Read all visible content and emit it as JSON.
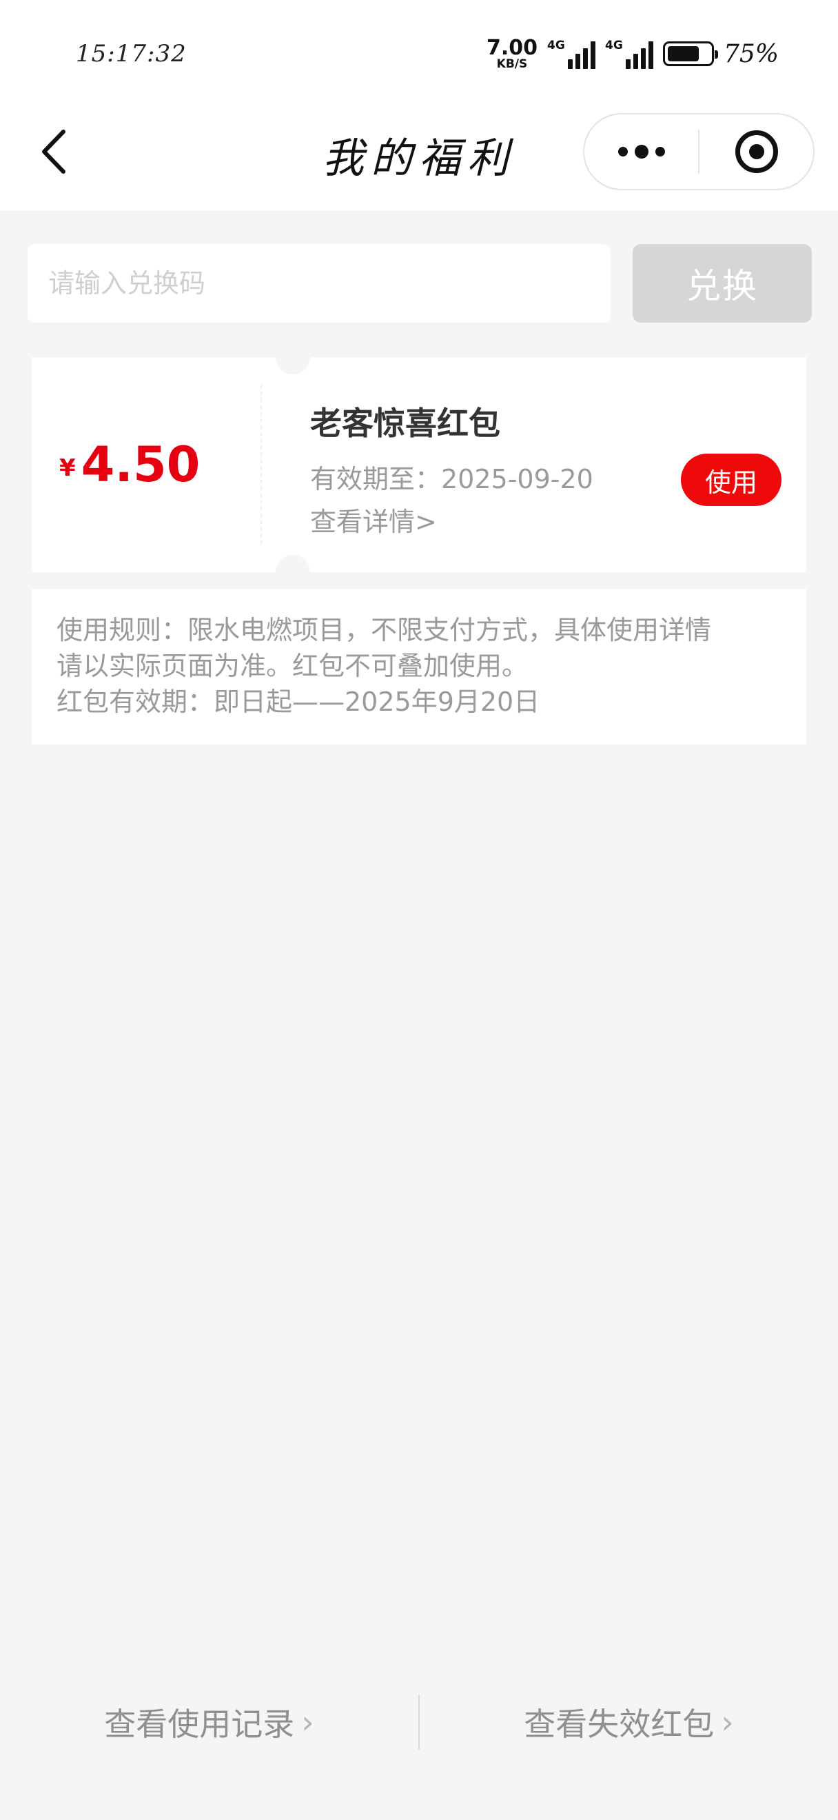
{
  "status_bar": {
    "time": "15:17:32",
    "net_speed_value": "7.00",
    "net_speed_unit": "KB/S",
    "sim1_tag": "4G",
    "sim2_tag": "4G",
    "battery_level": 75,
    "battery_text": "75%"
  },
  "nav": {
    "title": "我的福利"
  },
  "redeem": {
    "placeholder": "请输入兑换码",
    "button_label": "兑换"
  },
  "coupon": {
    "currency": "¥",
    "amount": "4.50",
    "title": "老客惊喜红包",
    "expiry": "有效期至：2025-09-20",
    "detail_link": "查看详情>",
    "use_label": "使用"
  },
  "rules": {
    "line1": "使用规则：限水电燃项目，不限支付方式，具体使用详情",
    "line2": "请以实际页面为准。红包不可叠加使用。",
    "line3": "红包有效期：即日起——2025年9月20日"
  },
  "footer": {
    "usage_record": "查看使用记录",
    "expired_packets": "查看失效红包"
  },
  "colors": {
    "accent_red": "#e60012",
    "button_red": "#ee0a0a",
    "disabled_gray": "#d6d6d6",
    "background": "#f4f5f7"
  }
}
